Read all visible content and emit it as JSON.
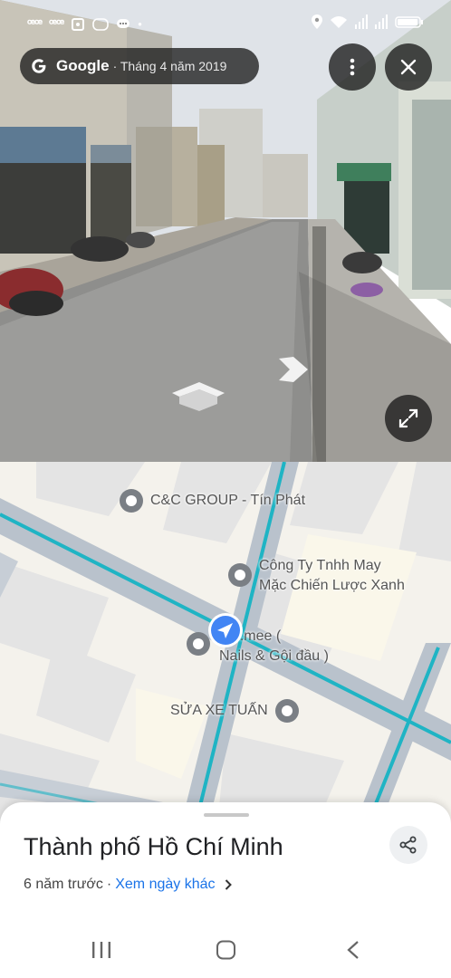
{
  "status_bar": {
    "left_icons": [
      "sim-icon",
      "sim-icon",
      "screenshot-icon",
      "zalo-icon",
      "chat-icon"
    ],
    "left_texts": [
      "ꟹꟹ",
      "ꟹꟹ"
    ],
    "right_icons": [
      "location-icon",
      "wifi-icon",
      "signal-icon",
      "signal-icon",
      "battery-icon"
    ]
  },
  "street_view": {
    "brand": "Google",
    "date": "· Tháng 4 năm 2019",
    "more_icon": "more-vert-icon",
    "close_icon": "close-icon",
    "expand_icon": "expand-icon"
  },
  "map": {
    "pois": [
      {
        "label": "C&C GROUP - Tín Phát"
      },
      {
        "label": "Công Ty Tnhh May\nMặc Chiến Lược Xanh"
      },
      {
        "label": "iluv.mee (\nNails & Gội đầu )"
      },
      {
        "label": "SỬA XE TUẤN"
      }
    ],
    "colors": {
      "road": "#b9c2cc",
      "route": "#1fb4c4",
      "block": "#e4e4e4",
      "bg": "#f4f2ec",
      "marker": "#4285f4"
    }
  },
  "sheet": {
    "title": "Thành phố Hồ Chí Minh",
    "time_ago": "6 năm trước",
    "separator": "·",
    "other_dates": "Xem ngày khác",
    "share_icon": "share-icon"
  },
  "system_nav": {
    "recents_icon": "recents-icon",
    "home_icon": "home-icon",
    "back_icon": "back-icon"
  }
}
